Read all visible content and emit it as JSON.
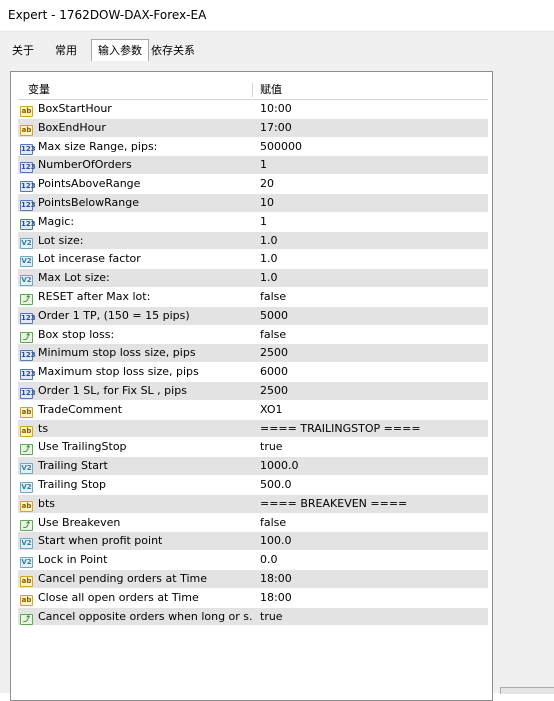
{
  "window": {
    "title": "Expert - 1762DOW-DAX-Forex-EA"
  },
  "tabs": [
    {
      "label": "关于",
      "active": false
    },
    {
      "label": "常用",
      "active": false
    },
    {
      "label": "输入参数",
      "active": true
    },
    {
      "label": "依存关系",
      "active": false
    }
  ],
  "grid": {
    "col_variable": "变量",
    "col_value": "赋值",
    "rows": [
      {
        "icon": "ab",
        "name": "BoxStartHour",
        "value": "10:00"
      },
      {
        "icon": "ab",
        "name": "BoxEndHour",
        "value": "17:00"
      },
      {
        "icon": "123",
        "name": "Max size Range, pips:",
        "value": "500000"
      },
      {
        "icon": "123",
        "name": "NumberOfOrders",
        "value": "1"
      },
      {
        "icon": "123",
        "name": "PointsAboveRange",
        "value": "20"
      },
      {
        "icon": "123",
        "name": "PointsBelowRange",
        "value": "10"
      },
      {
        "icon": "123",
        "name": "Magic:",
        "value": "1"
      },
      {
        "icon": "v2",
        "name": "Lot size:",
        "value": "1.0"
      },
      {
        "icon": "v2",
        "name": "Lot incerase factor",
        "value": "1.0"
      },
      {
        "icon": "v2",
        "name": "Max Lot size:",
        "value": "1.0"
      },
      {
        "icon": "bool",
        "name": "RESET after Max lot:",
        "value": "false"
      },
      {
        "icon": "123",
        "name": "Order 1 TP, (150 = 15 pips)",
        "value": "5000"
      },
      {
        "icon": "bool",
        "name": "Box stop loss:",
        "value": "false"
      },
      {
        "icon": "123",
        "name": "Minimum stop loss size, pips",
        "value": "2500"
      },
      {
        "icon": "123",
        "name": "Maximum stop loss size, pips",
        "value": "6000"
      },
      {
        "icon": "123",
        "name": "Order 1 SL, for Fix SL , pips",
        "value": "2500"
      },
      {
        "icon": "ab",
        "name": "TradeComment",
        "value": "XO1"
      },
      {
        "icon": "ab",
        "name": "ts",
        "value": "==== TRAILINGSTOP ===="
      },
      {
        "icon": "bool",
        "name": "Use TrailingStop",
        "value": "true"
      },
      {
        "icon": "v2",
        "name": "Trailing Start",
        "value": "1000.0"
      },
      {
        "icon": "v2",
        "name": "Trailing Stop",
        "value": "500.0"
      },
      {
        "icon": "ab",
        "name": "bts",
        "value": "==== BREAKEVEN ===="
      },
      {
        "icon": "bool",
        "name": "Use Breakeven",
        "value": "false"
      },
      {
        "icon": "v2",
        "name": "Start when profit point",
        "value": "100.0"
      },
      {
        "icon": "v2",
        "name": "Lock in Point",
        "value": "0.0"
      },
      {
        "icon": "ab",
        "name": "Cancel pending orders at Time",
        "value": "18:00"
      },
      {
        "icon": "ab",
        "name": "Close all open orders at Time",
        "value": "18:00"
      },
      {
        "icon": "bool",
        "name": "Cancel opposite orders when long or s...",
        "value": "true"
      }
    ]
  },
  "icons": {
    "ab": {
      "name": "string-type-icon",
      "glyph": "ab"
    },
    "123": {
      "name": "integer-type-icon",
      "glyph": "123"
    },
    "v2": {
      "name": "double-type-icon",
      "glyph": "V2"
    },
    "bool": {
      "name": "boolean-type-icon",
      "glyph": "⤴"
    }
  },
  "colors": {
    "alt_row": "#e3e3e3",
    "panel": "#f0f0f0"
  }
}
